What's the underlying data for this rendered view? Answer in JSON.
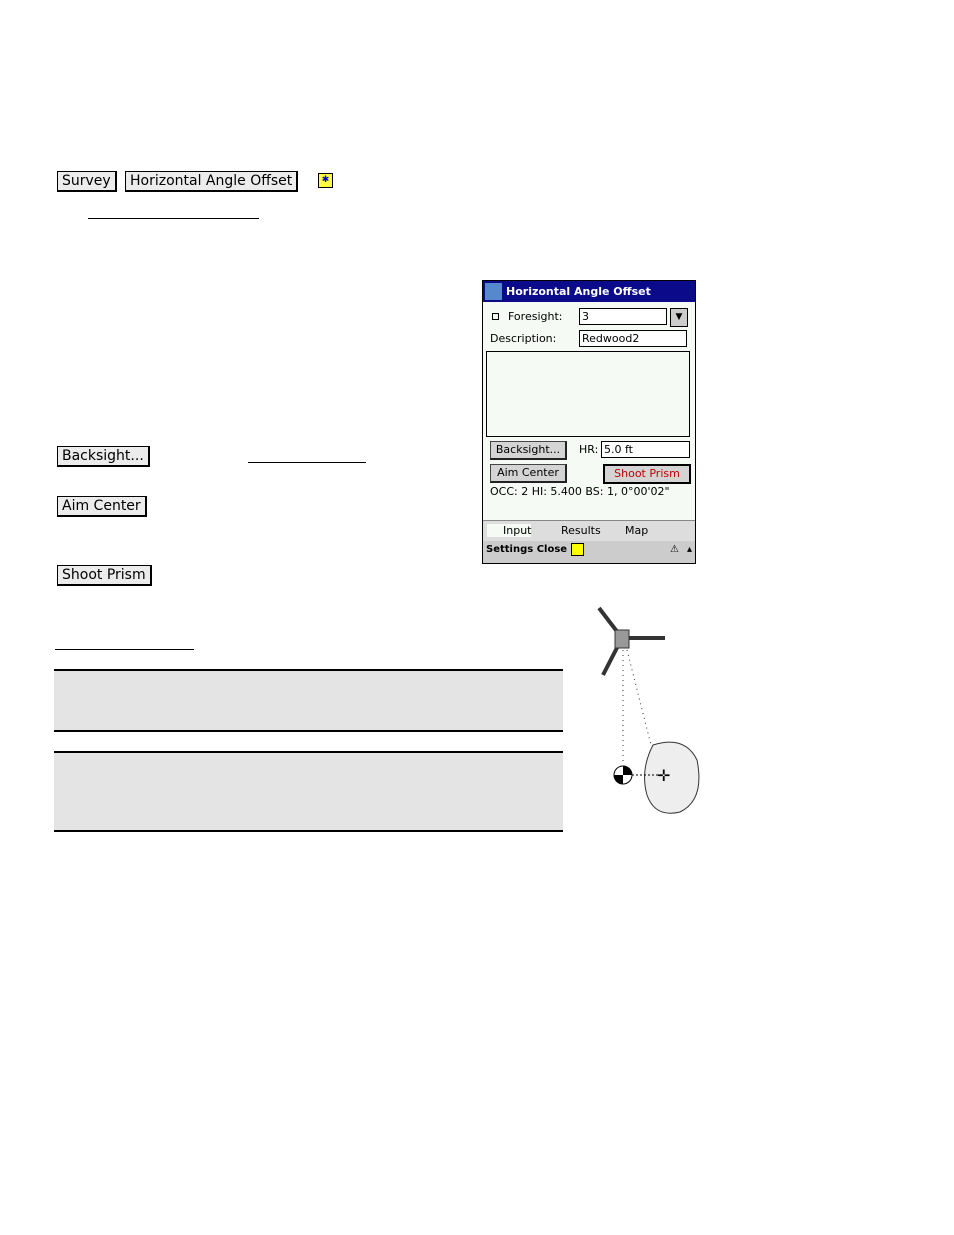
{
  "header": {
    "buttons": [
      "Survey",
      "Horizontal Angle Offset"
    ],
    "icon": "ok-icon"
  },
  "side_buttons": {
    "backsight": "Backsight...",
    "aim_center": "Aim Center",
    "shoot_prism": "Shoot Prism"
  },
  "device": {
    "title": "Horizontal Angle Offset",
    "foresight_label": "Foresight:",
    "foresight_value": "3",
    "description_label": "Description:",
    "description_value": "Redwood2",
    "backsight_btn": "Backsight...",
    "hr_label": "HR:",
    "hr_value": "5.0 ft",
    "aim_center_btn": "Aim Center",
    "shoot_prism_btn": "Shoot Prism",
    "status": "OCC: 2  HI: 5.400  BS: 1, 0°00'02\"",
    "tabs": [
      "Input",
      "Results",
      "Map"
    ],
    "footer": {
      "settings": "Settings",
      "close": "Close"
    }
  },
  "colors": {
    "title_bg": "#0a0a8a",
    "shoot_prism_text": "#c00000",
    "note_bg": "#e4e4e4"
  }
}
